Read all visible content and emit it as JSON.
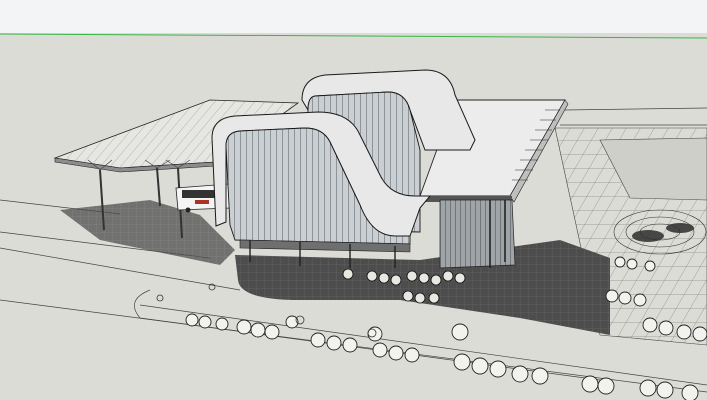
{
  "viewport": {
    "sky_color": "#f3f4f6",
    "ground_color": "#dcdcd6",
    "horizon_axis_color": "#3bb54a",
    "shadow_color": "#4d4d4d",
    "edge_color": "#1a1a1a",
    "glass_color": "#c9cfd2",
    "roof_color": "#e8e8e8"
  },
  "scene": {
    "model": "station-building",
    "vehicle": "bus",
    "vegetation": "tree-symbols",
    "site": "plaza-paving"
  }
}
